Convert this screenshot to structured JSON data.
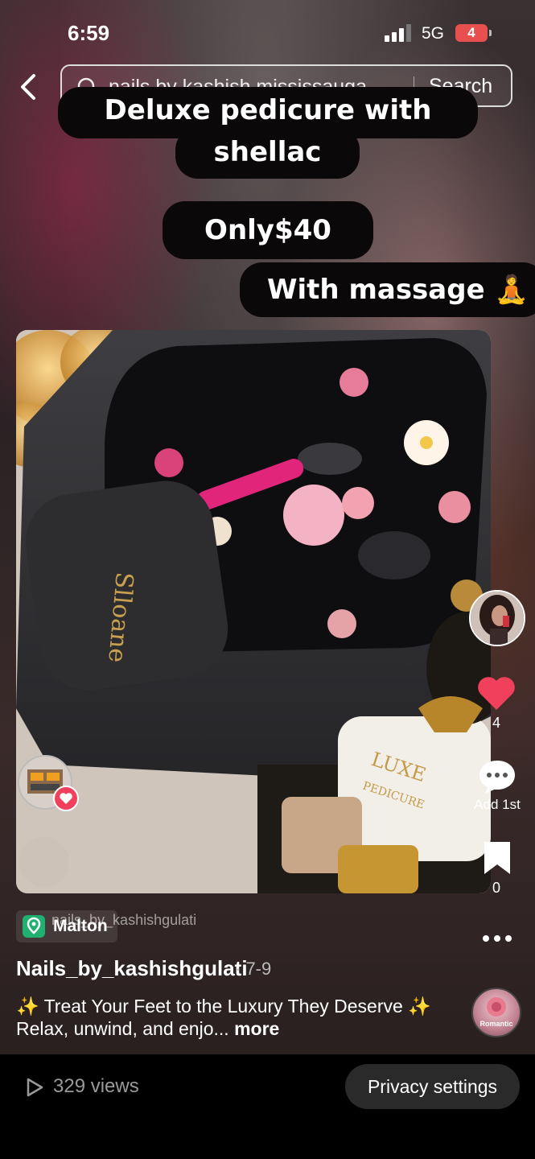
{
  "status_bar": {
    "time": "6:59",
    "network": "5G",
    "battery": "4"
  },
  "search": {
    "query": "nails by kashish mississauga",
    "button": "Search"
  },
  "captions": {
    "line1": "Deluxe pedicure with",
    "line2": "shellac",
    "price": "Only$40",
    "massage": "With massage 🧘"
  },
  "photo": {
    "brand_text": "Slloane",
    "towel_text": "LUXE PEDICURE"
  },
  "actions": {
    "likes": "4",
    "comment_label": "Add 1st",
    "bookmarks": "0"
  },
  "post": {
    "location": "Malton",
    "watermark": "nails_by_kashishgulati",
    "author": "Nails_by_kashishgulati",
    "date": "· 7-9",
    "description": "✨ Treat Your Feet to the Luxury They Deserve ✨ Relax, unwind, and enjo...",
    "more": "more",
    "sound_label": "Romantic"
  },
  "bottom_bar": {
    "views": "329 views",
    "privacy_button": "Privacy settings"
  },
  "colors": {
    "like": "#f0405c",
    "location_icon": "#20b070",
    "bottom_bar": "#000000"
  }
}
